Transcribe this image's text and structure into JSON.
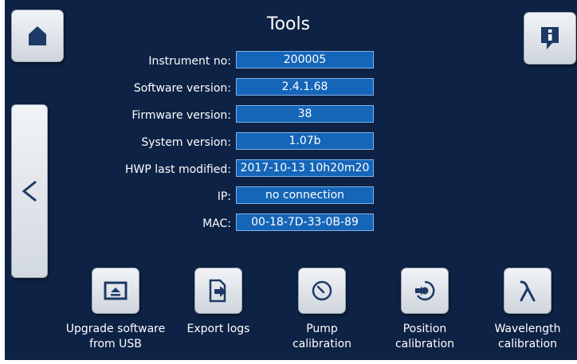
{
  "title": "Tools",
  "info_rows": [
    {
      "label": "Instrument no:",
      "value": "200005"
    },
    {
      "label": "Software version:",
      "value": "2.4.1.68"
    },
    {
      "label": "Firmware version:",
      "value": "38"
    },
    {
      "label": "System version:",
      "value": "1.07b"
    },
    {
      "label": "HWP last modified:",
      "value": "2017-10-13 10h20m20"
    },
    {
      "label": "IP:",
      "value": "no connection"
    },
    {
      "label": "MAC:",
      "value": "00-18-7D-33-0B-89"
    }
  ],
  "tools": [
    {
      "label": "Upgrade software\nfrom USB",
      "icon": "upload-image-icon"
    },
    {
      "label": "Export logs",
      "icon": "export-file-icon"
    },
    {
      "label": "Pump\ncalibration",
      "icon": "gauge-icon"
    },
    {
      "label": "Position\ncalibration",
      "icon": "position-target-icon"
    },
    {
      "label": "Wavelength\ncalibration",
      "icon": "lambda-icon"
    }
  ],
  "nav": {
    "home_icon": "home-icon",
    "info_icon": "info-icon",
    "back_icon": "back-chevron-icon",
    "back_glyph": "<"
  },
  "colors": {
    "background": "#0d2244",
    "value_field": "#1565b8",
    "icon": "#1d3a66"
  }
}
